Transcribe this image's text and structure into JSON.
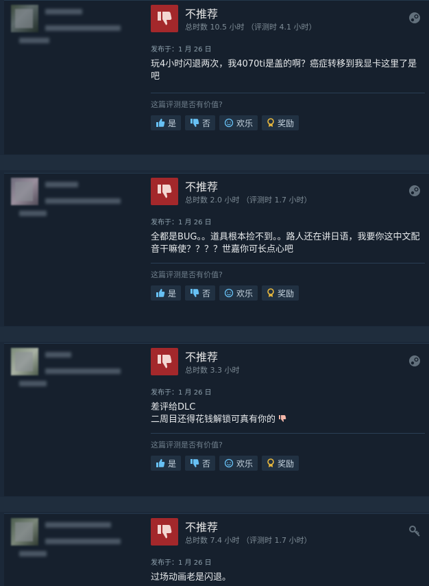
{
  "colors": {
    "background": "#1b2838",
    "card": "#16202d",
    "thumb_bg": "#a3282b",
    "button_bg": "#213142"
  },
  "helpful_prompt": "这篇评测是否有价值?",
  "buttons": {
    "yes": "是",
    "no": "否",
    "funny": "欢乐",
    "award": "奖励"
  },
  "reviews": [
    {
      "verdict": "不推荐",
      "hours": "总时数 10.5 小时 （评测时 4.1 小时）",
      "posted": "发布于：1 月 26 日",
      "content": "玩4小时闪退两次，我4070ti是盖的啊？癌症转移到我显卡这里了是吧",
      "source_icon": "steam-icon"
    },
    {
      "verdict": "不推荐",
      "hours": "总时数 2.0 小时 （评测时 1.7 小时）",
      "posted": "发布于：1 月 26 日",
      "content": "全都是BUG。。道具根本捡不到。。路人还在讲日语，我要你这中文配音干嘛使？？？？世嘉你可长点心吧",
      "source_icon": "steam-icon"
    },
    {
      "verdict": "不推荐",
      "hours": "总时数 3.3 小时",
      "posted": "发布于：1 月 26 日",
      "content_line1": "差评给DLC",
      "content_line2": "二周目还得花钱解锁可真有你的",
      "source_icon": "steam-icon"
    },
    {
      "verdict": "不推荐",
      "hours": "总时数 7.4 小时 （评测时 1.7 小时）",
      "posted": "发布于：1 月 26 日",
      "content": "过场动画老是闪退。",
      "source_icon": "key-icon"
    }
  ]
}
